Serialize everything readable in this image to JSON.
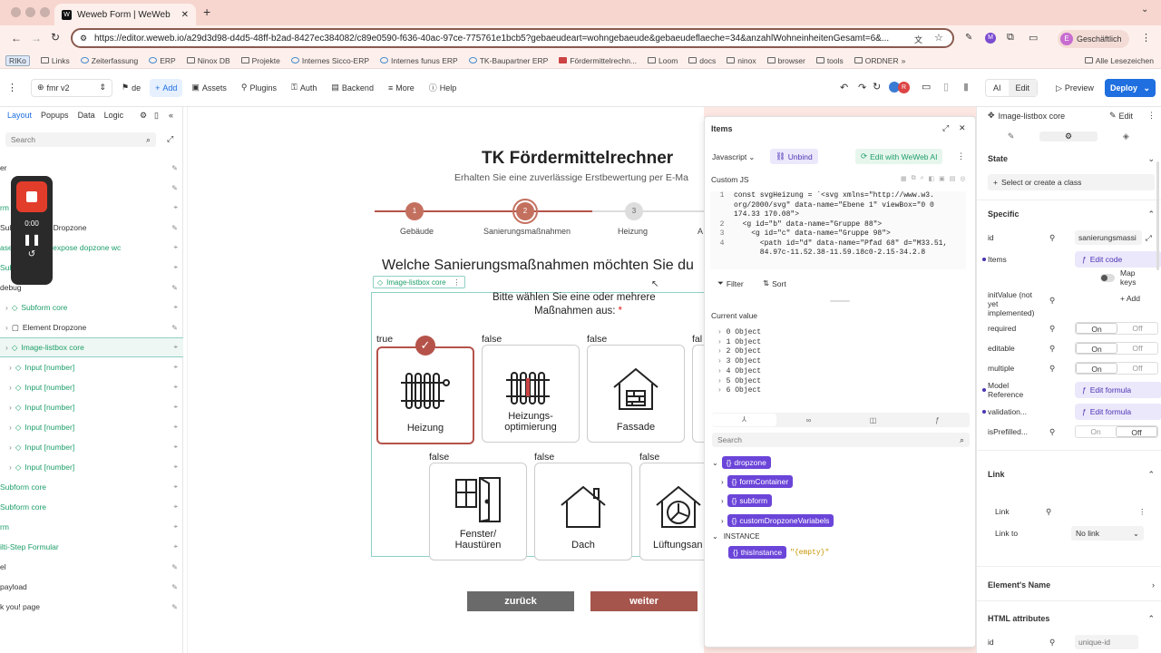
{
  "browser": {
    "tab_title": "Weweb Form | WeWeb",
    "url": "https://editor.weweb.io/a29d3d98-d4d5-48ff-b2ad-8427ec384082/c89e0590-f636-40ac-97ce-775761e1bcb5?gebaeudeart=wohngebaeude&gebaeudeflaeche=34&anzahlWohneinheitenGesamt=6&...",
    "profile": "Geschäftlich",
    "profile_initial": "E",
    "bookmarks": [
      "RIKo",
      "Links",
      "Zeiterfassung",
      "ERP",
      "Ninox DB",
      "Projekte",
      "Internes Sicco-ERP",
      "Internes funus ERP",
      "TK-Baupartner ERP",
      "Fördermittelrechn...",
      "Loom",
      "docs",
      "ninox",
      "browser",
      "tools",
      "ORDNER"
    ],
    "all_bookmarks": "Alle Lesezeichen"
  },
  "toolbar": {
    "page": "fmr v2",
    "lang": "de",
    "add": "Add",
    "assets": "Assets",
    "plugins": "Plugins",
    "auth": "Auth",
    "backend": "Backend",
    "more": "More",
    "help": "Help",
    "avatar_initial": "R",
    "ai": "AI",
    "edit": "Edit",
    "preview": "Preview",
    "deploy": "Deploy"
  },
  "left": {
    "tabs": [
      "Layout",
      "Popups",
      "Data",
      "Logic"
    ],
    "search_placeholder": "Search",
    "recorder_time": "0:00",
    "tree": [
      {
        "label": "er",
        "indent": 0,
        "green": false
      },
      {
        "label": "",
        "indent": 0,
        "green": false
      },
      {
        "label": "rm",
        "indent": 0,
        "green": true
      },
      {
        "label": "Subform core  ·  Dropzone",
        "indent": 0,
        "green": false
      },
      {
        "label": "ased; does not expose dopzone wc",
        "indent": 0,
        "green": true
      },
      {
        "label": "Subform core",
        "indent": 0,
        "green": true
      },
      {
        "label": "debug",
        "indent": 0,
        "green": false
      },
      {
        "label": "Subform core",
        "indent": 1,
        "green": true
      },
      {
        "label": "Element Dropzone",
        "indent": 1,
        "green": false
      },
      {
        "label": "Image-listbox core",
        "indent": 1,
        "green": true
      },
      {
        "label": "Input [number]",
        "indent": 2,
        "green": true
      },
      {
        "label": "Input [number]",
        "indent": 2,
        "green": true
      },
      {
        "label": "Input [number]",
        "indent": 2,
        "green": true
      },
      {
        "label": "Input [number]",
        "indent": 2,
        "green": true
      },
      {
        "label": "Input [number]",
        "indent": 2,
        "green": true
      },
      {
        "label": "Input [number]",
        "indent": 2,
        "green": true
      },
      {
        "label": "Subform core",
        "indent": 0,
        "green": true
      },
      {
        "label": "Subform core",
        "indent": 0,
        "green": true
      },
      {
        "label": "rm",
        "indent": 0,
        "green": true
      },
      {
        "label": "ilti-Step Formular",
        "indent": 0,
        "green": true
      },
      {
        "label": "el",
        "indent": 0,
        "green": false
      },
      {
        "label": "payload",
        "indent": 0,
        "green": false
      },
      {
        "label": "k you! page",
        "indent": 0,
        "green": false
      }
    ]
  },
  "canvas": {
    "title": "TK Fördermittelrechner",
    "subtitle": "Erhalten Sie eine zuverlässige Erstbewertung per E-Ma",
    "steps": [
      {
        "num": "1",
        "label": "Gebäude",
        "done": true
      },
      {
        "num": "2",
        "label": "Sanierungsmaßnahmen",
        "active": true
      },
      {
        "num": "3",
        "label": "Heizung"
      },
      {
        "num": "",
        "label": "A"
      }
    ],
    "question": "Welche Sanierungsmaßnahmen möchten Sie du",
    "element_tag": "Image-listbox core",
    "instruction_line1": "Bitte wählen Sie eine oder mehrere",
    "instruction_line2": "Maßnahmen aus:",
    "required_mark": "*",
    "options_row1": [
      {
        "flag": "true",
        "label": "Heizung",
        "selected": true
      },
      {
        "flag": "false",
        "label": "Heizungs-\noptimierung"
      },
      {
        "flag": "false",
        "label": "Fassade"
      },
      {
        "flag": "fal",
        "label": ""
      }
    ],
    "options_row2": [
      {
        "flag": "false",
        "label": "Fenster/\nHaustüren"
      },
      {
        "flag": "false",
        "label": "Dach"
      },
      {
        "flag": "false",
        "label": "Lüftungsan"
      }
    ],
    "back": "zurück",
    "next": "weiter"
  },
  "items": {
    "title": "Items",
    "lang": "Javascript",
    "unbind": "Unbind",
    "edit_ai": "Edit with WeWeb AI",
    "custom_js": "Custom JS",
    "code_lines": [
      {
        "n": "1",
        "text": "const svgHeizung = `<svg xmlns=\"http://www.w3."
      },
      {
        "n": "",
        "text": "org/2000/svg\" data-name=\"Ebene 1\" viewBox=\"0 0"
      },
      {
        "n": "",
        "text": "174.33 170.08\">"
      },
      {
        "n": "2",
        "text": "  <g id=\"b\" data-name=\"Gruppe 88\">"
      },
      {
        "n": "3",
        "text": "    <g id=\"c\" data-name=\"Gruppe 98\">"
      },
      {
        "n": "4",
        "text": "      <path id=\"d\" data-name=\"Pfad 68\" d=\"M33.51,"
      },
      {
        "n": "",
        "text": "      84.97c-11.52.38-11.59.18c0-2.15-34.2.8"
      }
    ],
    "filter": "Filter",
    "sort": "Sort",
    "current_value": "Current value",
    "values": [
      "0 Object",
      "1 Object",
      "2 Object",
      "3 Object",
      "4 Object",
      "5 Object",
      "6 Object"
    ],
    "search_placeholder": "Search",
    "vars": [
      "dropzone",
      "formContainer",
      "subform",
      "customDropzoneVariabels"
    ],
    "instance_label": "INSTANCE",
    "instance_var": "thisInstance",
    "instance_value": "\"{empty}\""
  },
  "props": {
    "element": "Image-listbox core",
    "edit": "Edit",
    "state": "State",
    "class_placeholder": "Select or create a class",
    "specific": "Specific",
    "id_label": "id",
    "id_value": "sanierungsmassi",
    "items_label": "Items",
    "edit_code": "Edit code",
    "map_keys": "Map keys",
    "init_label": "initValue (not yet implemented)",
    "add": "Add",
    "required": "required",
    "editable": "editable",
    "multiple": "multiple",
    "model_ref": "Model Reference",
    "validation": "validation...",
    "prefilled": "isPrefilled...",
    "edit_formula": "Edit formula",
    "on": "On",
    "off": "Off",
    "link_section": "Link",
    "link_label": "Link",
    "link_to": "Link to",
    "no_link": "No link",
    "element_name": "Element's Name",
    "html_attrs": "HTML attributes",
    "html_id": "id",
    "unique_id_placeholder": "unique-id"
  }
}
